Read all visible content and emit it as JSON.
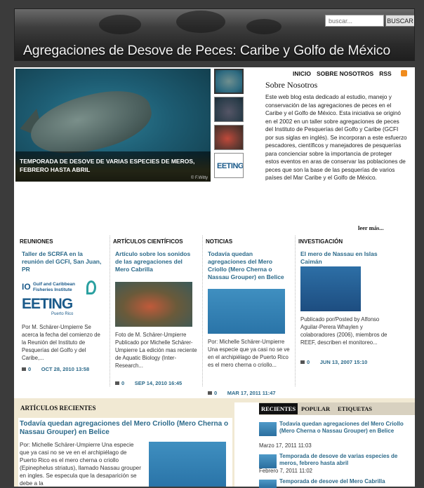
{
  "header": {
    "title": "Agregaciones de Desove de Peces: Caribe y Golfo de México",
    "search_placeholder": "buscar...",
    "search_button": "BUSCAR"
  },
  "nav": {
    "items": [
      "INICIO",
      "SOBRE NOSOTROS",
      "RSS"
    ]
  },
  "feature": {
    "caption": "TEMPORADA DE DESOVE DE VARIAS ESPECIES DE MEROS, FEBRERO HASTA ABRIL",
    "credit": "© F.Witty",
    "thumb4_text": "EETING"
  },
  "about": {
    "title": "Sobre Nosotros",
    "text": "Este web blog esta dedicado al estudio, manejo y conservación de las agregaciones de peces en el Caribe y el Golfo de México. Esta iniciativa se originó en el 2002 en un taller sobre agregaciones de peces del Instituto de Pesquerías del Golfo y Caribe (GCFI por sus siglas en inglés). Se incorporan a este esfuerzo pescadores, científicos y manejadores de pesquerías para concienciar sobre la importancia de proteger estos eventos en aras de conservar las poblaciones de peces que son la base de las pesquerías de varios países del Mar Caribe y el Golfo de México.",
    "more": "leer más..."
  },
  "columns": [
    {
      "head": "REUNIONES",
      "title": "Taller de SCRFA en la reunión del GCFI, San Juan, PR",
      "logo_line1": "Gulf and Caribbean",
      "logo_line2": "Fisheries Institute",
      "logo_big": "EETING",
      "logo_small": "Puerto Rico",
      "text": "Por M. Schärer-Umpierre Se acerca la fecha del comienzo de la Reunión del Instituto de Pesquerías del Golfo y del Caribe,...",
      "comments": "0",
      "date": "OCT 28, 2010 13:58"
    },
    {
      "head": "ARTÍCULOS CIENTÍFICOS",
      "title": "Artículo sobre los sonidos de las agregaciones del Mero Cabrilla",
      "text": "Foto de M. Schärer-Umpierre Publicado por Michelle Schärer-Umpierre La edición mas reciente de Aquatic Biology (Inter-Research...",
      "comments": "0",
      "date": "SEP 14, 2010 16:45"
    },
    {
      "head": "NOTICIAS",
      "title": "Todavía quedan agregaciones del Mero Criollo (Mero Cherna o Nassau Grouper) en Belice",
      "text": "Por: Michelle Schärer-Umpierre Una especie que ya casi no se ve en el archipiélago de Puerto Rico es el mero cherna o criollo...",
      "comments": "0",
      "date": "MAR 17, 2011 11:47"
    },
    {
      "head": "INVESTIGACIÓN",
      "title": "El mero de Nassau en Islas Caimán",
      "text": "Publicado por/Posted by Alfonso Aguilar-Perera Whaylen y colaboradores (2006), miembros de REEF, describen el monitoreo...",
      "comments": "0",
      "date": "JUN 13, 2007 15:10"
    }
  ],
  "recent": {
    "head": "ARTÍCULOS RECIENTES",
    "title": "Todavía quedan agregaciones del Mero Criollo (Mero Cherna o Nassau Grouper) en Belice",
    "text": "Por: Michelle Schärer-Umpierre Una especie que ya casi no se ve en el archipiélago de Puerto Rico es el mero cherna o criollo (Epinephelus striatus), llamado Nassau grouper en ingles. Se especula que la desaparición se debe a la"
  },
  "sidebar": {
    "tabs": [
      "RECIENTES",
      "POPULAR",
      "ETIQUETAS"
    ],
    "items": [
      {
        "title": "Todavía quedan agregaciones del Mero Criollo (Mero Cherna o Nassau Grouper) en Belice",
        "date": "Marzo 17, 2011 11:03"
      },
      {
        "title": "Temporada de desove de varias especies de meros, febrero hasta abril",
        "date": "Febrero 7, 2011 11:02"
      },
      {
        "title": "Temporada de desove del Mero Cabrilla",
        "date": ""
      }
    ]
  }
}
